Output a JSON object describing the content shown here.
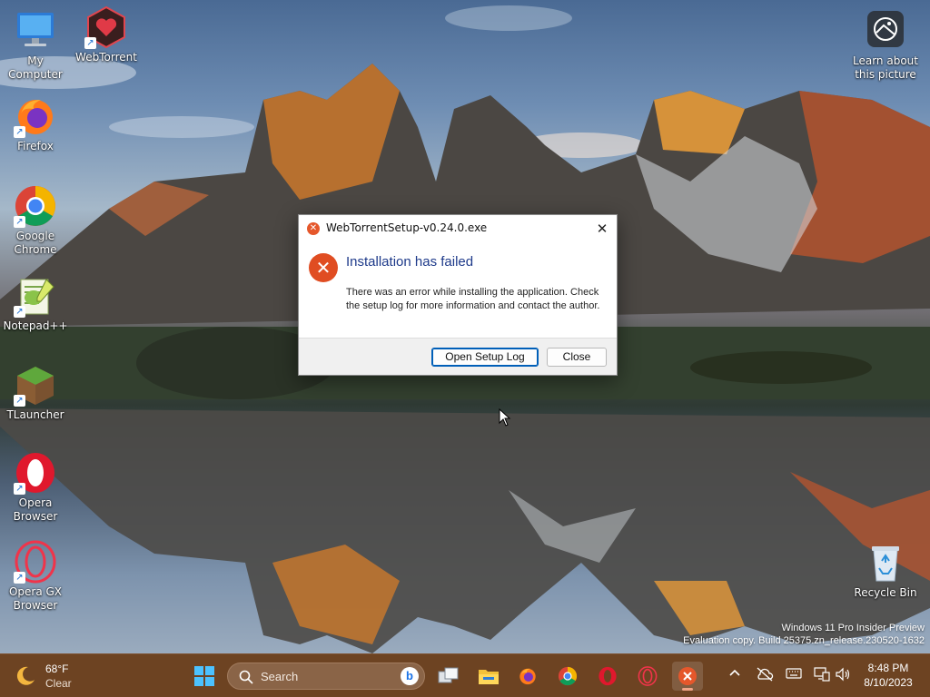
{
  "desktop": {
    "icons": [
      {
        "label_1": "My Computer",
        "label_2": "",
        "icon": "computer-icon"
      },
      {
        "label_1": "WebTorrent",
        "label_2": "",
        "icon": "webtorrent-icon"
      },
      {
        "label_1": "Firefox",
        "label_2": "",
        "icon": "firefox-icon"
      },
      {
        "label_1": "Google",
        "label_2": "Chrome",
        "icon": "chrome-icon"
      },
      {
        "label_1": "Notepad++",
        "label_2": "",
        "icon": "notepadpp-icon"
      },
      {
        "label_1": "TLauncher",
        "label_2": "",
        "icon": "tlauncher-icon"
      },
      {
        "label_1": "Opera",
        "label_2": "Browser",
        "icon": "opera-icon"
      },
      {
        "label_1": "Opera GX",
        "label_2": "Browser",
        "icon": "opera-gx-icon"
      },
      {
        "label_1": "Recycle Bin",
        "label_2": "",
        "icon": "recycle-bin-icon"
      }
    ],
    "spotlight": {
      "label_1": "Learn about",
      "label_2": "this picture",
      "icon": "camera-spotlight-icon"
    },
    "watermark": {
      "line1": "Windows 11 Pro Insider Preview",
      "line2": "Evaluation copy. Build 25375.zn_release.230520-1632"
    }
  },
  "dialog": {
    "title": "WebTorrentSetup-v0.24.0.exe",
    "close_glyph": "✕",
    "heading": "Installation has failed",
    "message": "There was an error while installing the application. Check the setup log for more information and contact the author.",
    "buttons": {
      "open_log": "Open Setup Log",
      "close": "Close"
    }
  },
  "taskbar": {
    "weather": {
      "temp": "68°F",
      "condition": "Clear"
    },
    "search": {
      "placeholder": "Search",
      "bing": "b"
    },
    "pinned": [
      "start-icon",
      "task-view-icon",
      "file-explorer-icon",
      "firefox-icon",
      "chrome-icon",
      "opera-icon",
      "opera-gx-icon",
      "webtorrent-setup-icon"
    ],
    "tray": {
      "chevron": "^",
      "time": "8:48 PM",
      "date": "8/10/2023"
    }
  },
  "colors": {
    "taskbar": "#6d4322",
    "dialog_heading": "#1e3a8a",
    "error_red": "#e04d22",
    "primary_button_border": "#005fb8"
  }
}
